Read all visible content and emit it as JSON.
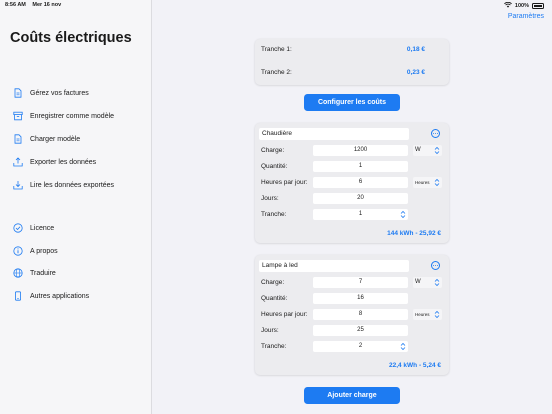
{
  "status": {
    "time": "8:56 AM",
    "date": "Mer 16 nov",
    "battery": "100%"
  },
  "sidebar": {
    "title": "Coûts électriques",
    "items": [
      {
        "label": "Gérez vos factures",
        "icon": "document-icon"
      },
      {
        "label": "Enregistrer comme modèle",
        "icon": "archive-icon"
      },
      {
        "label": "Charger modèle",
        "icon": "document-icon"
      },
      {
        "label": "Exporter les données",
        "icon": "tray-upload-icon"
      },
      {
        "label": "Lire les données exportées",
        "icon": "tray-download-icon"
      },
      {
        "label": "Licence",
        "icon": "checkmark-circle-icon"
      },
      {
        "label": "A propos",
        "icon": "info-circle-icon"
      },
      {
        "label": "Traduire",
        "icon": "globe-icon"
      },
      {
        "label": "Autres applications",
        "icon": "phone-icon"
      }
    ]
  },
  "header": {
    "params_label": "Paramètres"
  },
  "tranches": [
    {
      "label": "Tranche 1:",
      "value": "0,18 €"
    },
    {
      "label": "Tranche 2:",
      "value": "0,23 €"
    }
  ],
  "configure_button": "Configurer les coûts",
  "add_button": "Ajouter charge",
  "labels": {
    "charge": "Charge:",
    "quantite": "Quantité:",
    "heures": "Heures par jour:",
    "jours": "Jours:",
    "tranche": "Tranche:"
  },
  "charges": [
    {
      "name": "Chaudière",
      "charge": "1200",
      "charge_unit": "W",
      "quantite": "1",
      "heures": "6",
      "heures_unit": "Heures",
      "jours": "20",
      "tranche": "1",
      "total": "144 kWh - 25,92 €"
    },
    {
      "name": "Lampe à led",
      "charge": "7",
      "charge_unit": "W",
      "quantite": "16",
      "heures": "8",
      "heures_unit": "Heures",
      "jours": "25",
      "tranche": "2",
      "total": "22,4 kWh - 5,24 €"
    }
  ],
  "colors": {
    "accent": "#1d7bf2",
    "card": "#ececef",
    "background": "#f2f2f7"
  }
}
